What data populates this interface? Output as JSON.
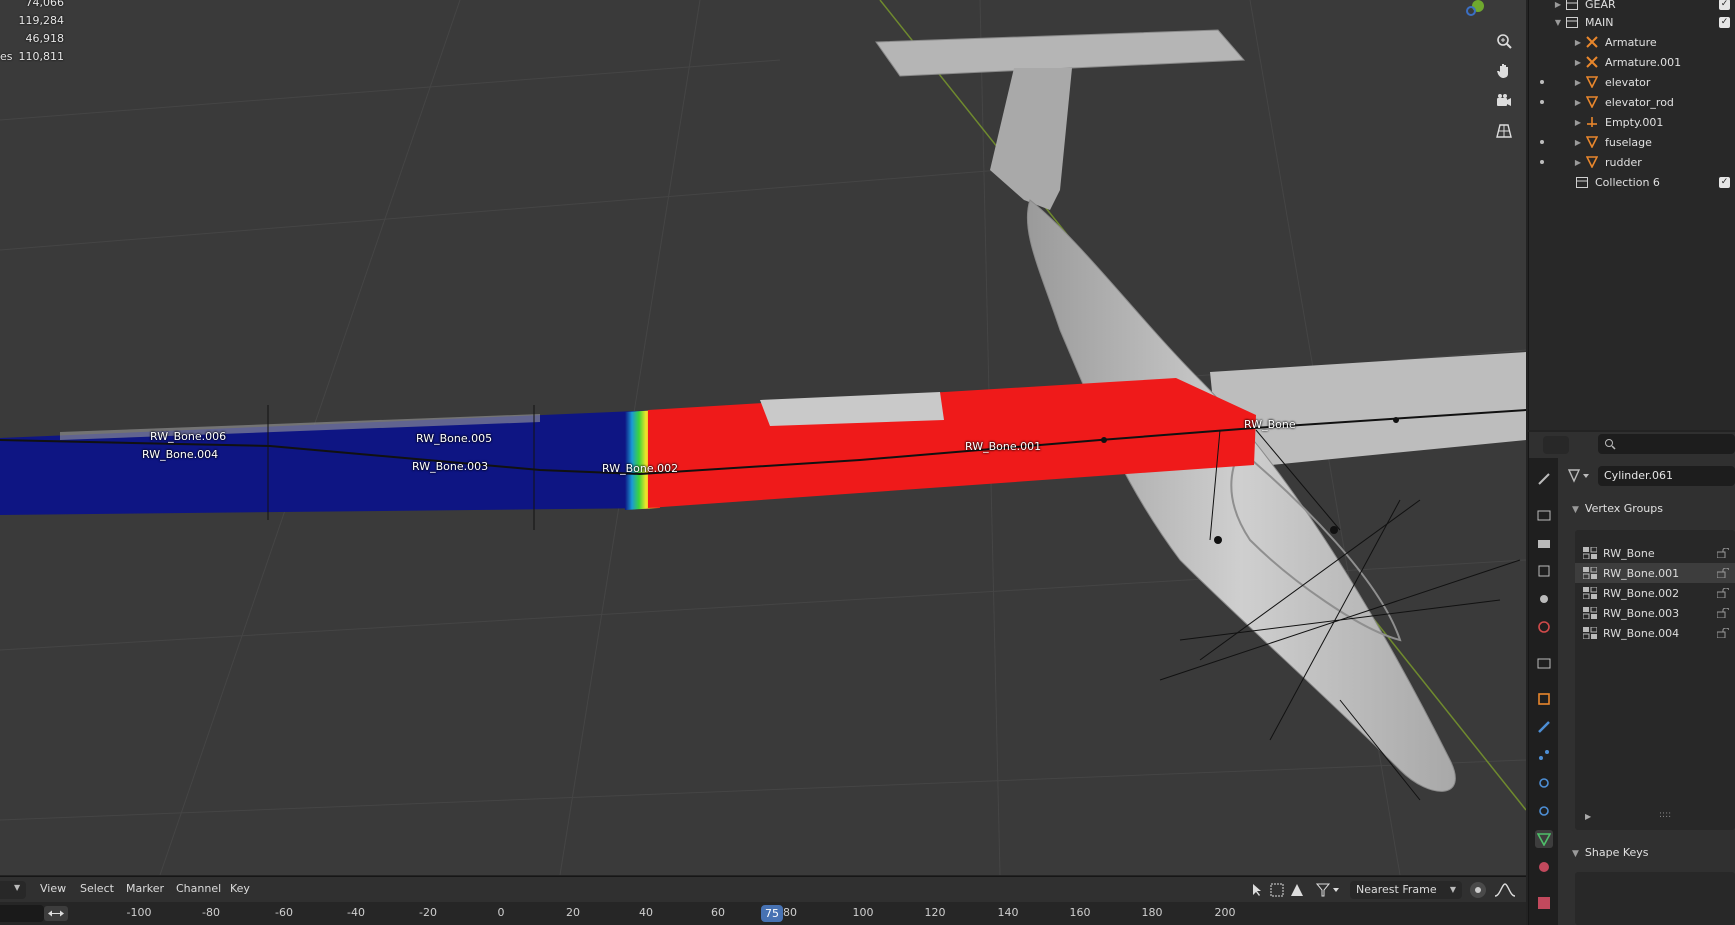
{
  "viewport": {
    "stats": [
      {
        "label": "",
        "value": "74,066"
      },
      {
        "label": "",
        "value": "119,284"
      },
      {
        "label": "",
        "value": "46,918"
      },
      {
        "label": "es",
        "value": "110,811"
      }
    ],
    "bone_labels": [
      "RW_Bone.006",
      "RW_Bone.004",
      "RW_Bone.005",
      "RW_Bone.003",
      "RW_Bone.002",
      "RW_Bone.001",
      "RW_Bone"
    ],
    "nav_icons": [
      "zoom-icon",
      "pan-hand-icon",
      "camera-icon",
      "grid-perspective-icon"
    ]
  },
  "outliner": {
    "rows": [
      {
        "name": "GEAR",
        "icon": "collection-icon",
        "depth": 1
      },
      {
        "name": "MAIN",
        "icon": "collection-icon",
        "depth": 1
      },
      {
        "name": "Armature",
        "icon": "armature-icon",
        "depth": 2
      },
      {
        "name": "Armature.001",
        "icon": "armature-icon",
        "depth": 2
      },
      {
        "name": "elevator",
        "icon": "mesh-icon",
        "depth": 2
      },
      {
        "name": "elevator_rod",
        "icon": "mesh-icon",
        "depth": 2
      },
      {
        "name": "Empty.001",
        "icon": "empty-icon",
        "depth": 2
      },
      {
        "name": "fuselage",
        "icon": "mesh-icon",
        "depth": 2
      },
      {
        "name": "rudder",
        "icon": "mesh-icon",
        "depth": 2
      },
      {
        "name": "Collection 6",
        "icon": "collection-icon",
        "depth": 1
      }
    ]
  },
  "properties": {
    "object_name": "Cylinder.061",
    "vertex_groups_title": "Vertex Groups",
    "vertex_groups": [
      "RW_Bone",
      "RW_Bone.001",
      "RW_Bone.002",
      "RW_Bone.003",
      "RW_Bone.004"
    ],
    "selected_group": "RW_Bone.001",
    "shape_keys_title": "Shape Keys",
    "list_resize_handle": "::::"
  },
  "timeline": {
    "menus": [
      "View",
      "Select",
      "Marker",
      "Channel",
      "Key"
    ],
    "interpolation": "Nearest Frame",
    "current_frame": "75",
    "ticks": [
      "-100",
      "-80",
      "-60",
      "-40",
      "-20",
      "0",
      "20",
      "40",
      "60",
      "80",
      "100",
      "120",
      "140",
      "160",
      "180",
      "200"
    ]
  },
  "colors": {
    "accent": "#4772b3",
    "weight_red": "#ef1a1a",
    "weight_blue": "#0e1583"
  }
}
